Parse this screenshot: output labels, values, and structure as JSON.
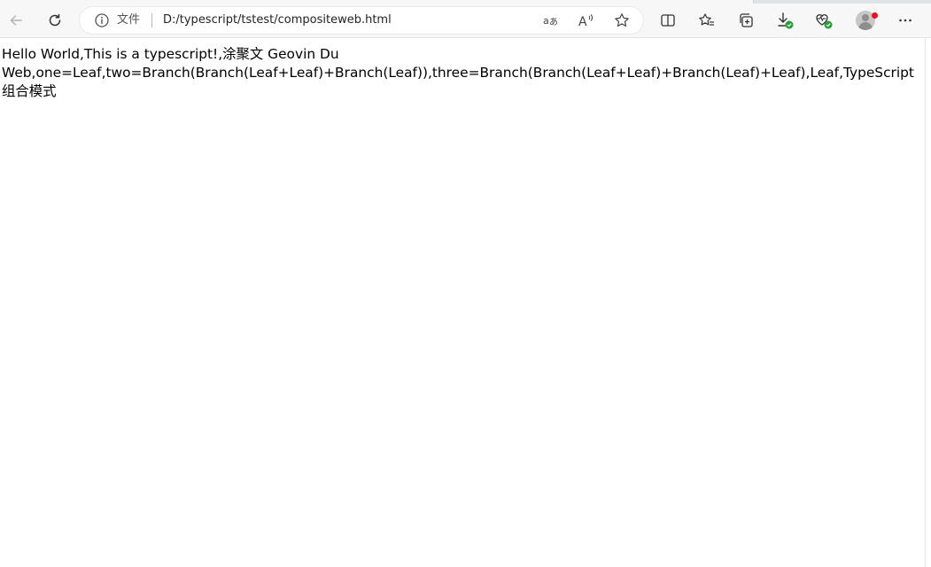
{
  "address_bar": {
    "site_info_label": "文件",
    "url": "D:/typescript/tstest/compositeweb.html"
  },
  "page": {
    "body_text": "Hello World,This is a typescript!,涂聚文 Geovin Du Web,one=Leaf,two=Branch(Branch(Leaf+Leaf)+Branch(Leaf)),three=Branch(Branch(Leaf+Leaf)+Branch(Leaf)+Leaf),Leaf,TypeScript 组合模式"
  },
  "icons": {
    "back": "back-arrow-icon",
    "refresh": "refresh-icon",
    "info": "info-icon",
    "read_aloud": "read-aloud-icon",
    "translate": "translate-icon",
    "favorite": "star-icon",
    "split_screen": "split-screen-icon",
    "favorites": "favorites-icon",
    "collections": "collections-icon",
    "downloads": "download-icon",
    "browser_essentials": "heart-pulse-icon",
    "profile": "avatar",
    "more": "more-icon"
  },
  "colors": {
    "toolbar_bg": "#f7f7f7",
    "download_badge": "#2a9d3c",
    "profile_dot": "#e81123"
  }
}
